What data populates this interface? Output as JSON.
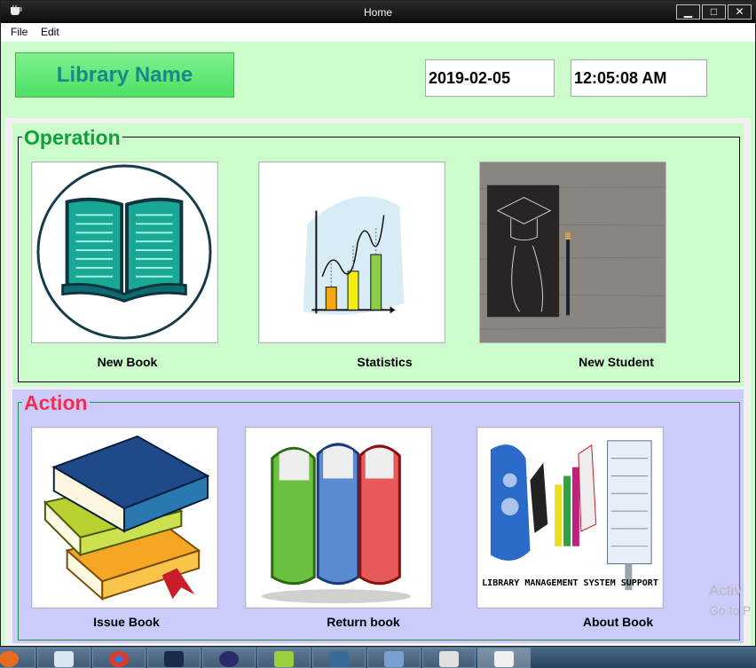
{
  "window": {
    "title": "Home",
    "minimize": "▁",
    "maximize": "□",
    "close": "✕"
  },
  "menu": {
    "file": "File",
    "edit": "Edit"
  },
  "header": {
    "library_name": "Library Name",
    "date": "2019-02-05",
    "time": "12:05:08 AM"
  },
  "operation": {
    "legend": "Operation",
    "tiles": [
      {
        "caption": "New Book",
        "icon": "open-book-icon"
      },
      {
        "caption": "Statistics",
        "icon": "bar-chart-icon"
      },
      {
        "caption": "New Student",
        "icon": "graduate-notebook-icon"
      }
    ]
  },
  "action": {
    "legend": "Action",
    "tiles": [
      {
        "caption": "Issue Book",
        "icon": "book-stack-icon"
      },
      {
        "caption": "Return book",
        "icon": "books-row-icon"
      },
      {
        "caption": "About Book",
        "icon": "about-banner-icon",
        "banner_text": "LIBRARY MANAGEMENT SYSTEM SUPPORT"
      }
    ]
  },
  "watermark": {
    "line1": "Activ",
    "line2": "Go to P"
  },
  "taskbar": [
    "firefox-icon",
    "notepad-icon",
    "chrome-icon",
    "cald3-icon",
    "eclipse-icon",
    "notepadpp-icon",
    "mysql-icon",
    "virtualbox-icon",
    "snipping-icon",
    "java-icon"
  ],
  "colors": {
    "operation_bg": "#ccfccc",
    "action_bg": "#ccccfc",
    "accent_green": "#10a03a",
    "accent_red": "#f03050",
    "library_text": "#178a8a"
  }
}
